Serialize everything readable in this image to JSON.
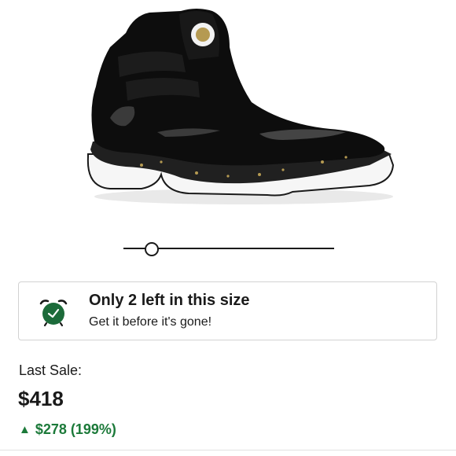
{
  "product": {
    "image_alt": "Black patent leather high-top sneaker with white sole and gold speckles"
  },
  "gallery_slider": {
    "position_fraction": 0.1
  },
  "stock_alert": {
    "icon": "alarm-clock-icon",
    "title": "Only 2 left in this size",
    "subtitle": "Get it before it's gone!",
    "accent_color": "#1c6b3a"
  },
  "last_sale": {
    "label": "Last Sale:",
    "price": "$418",
    "change_icon": "triangle-up-icon",
    "change": "$278 (199%)",
    "change_color": "#1c7a3a"
  }
}
